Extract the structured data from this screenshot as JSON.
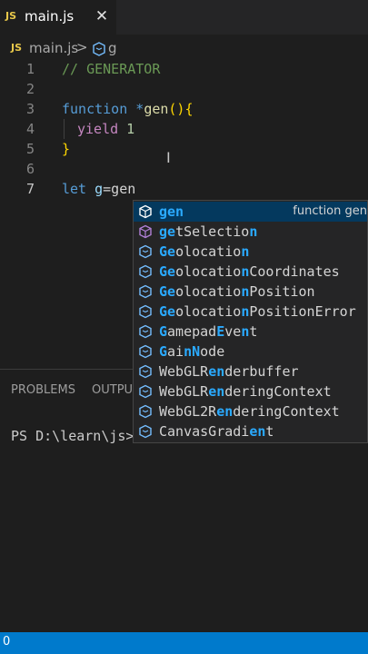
{
  "tab": {
    "badge": "JS",
    "name": "main.js",
    "close": "✕"
  },
  "breadcrumb": {
    "badge": "JS",
    "file": "main.js",
    "separator": ">",
    "symbol": "g"
  },
  "editor": {
    "lines": [
      {
        "n": "1",
        "text": "// GENERATOR"
      },
      {
        "n": "2",
        "text": ""
      },
      {
        "n": "3",
        "text": "function *gen(){"
      },
      {
        "n": "4",
        "text": "yield 1"
      },
      {
        "n": "5",
        "text": "}"
      },
      {
        "n": "6",
        "text": ""
      },
      {
        "n": "7",
        "text": "let g=gen"
      }
    ],
    "tokens": {
      "l1": "// GENERATOR",
      "l3_kw": "function",
      "l3_star": " *",
      "l3_fn": "gen",
      "l3_paren": "()",
      "l3_brace": "{",
      "l4_ctl": "yield",
      "l4_num": " 1",
      "l5_brace": "}",
      "l7_kw": "let",
      "l7_id": " g",
      "l7_rest": "=gen"
    }
  },
  "panel": {
    "tabs": [
      "PROBLEMS",
      "OUTPUT"
    ],
    "terminal_prompt": "PS D:\\learn\\js>"
  },
  "suggest": {
    "detail": "function gen",
    "items": [
      {
        "icon": "cube-icon",
        "parts": [
          [
            "gen",
            true
          ]
        ]
      },
      {
        "icon": "method-icon",
        "parts": [
          [
            "ge",
            true
          ],
          [
            "tSelectio",
            false
          ],
          [
            "n",
            true
          ]
        ]
      },
      {
        "icon": "variable-icon",
        "parts": [
          [
            "Ge",
            true
          ],
          [
            "olocatio",
            false
          ],
          [
            "n",
            true
          ]
        ]
      },
      {
        "icon": "variable-icon",
        "parts": [
          [
            "Ge",
            true
          ],
          [
            "olocatio",
            false
          ],
          [
            "n",
            true
          ],
          [
            "Coordinates",
            false
          ]
        ]
      },
      {
        "icon": "variable-icon",
        "parts": [
          [
            "Ge",
            true
          ],
          [
            "olocatio",
            false
          ],
          [
            "n",
            true
          ],
          [
            "Position",
            false
          ]
        ]
      },
      {
        "icon": "variable-icon",
        "parts": [
          [
            "Ge",
            true
          ],
          [
            "olocatio",
            false
          ],
          [
            "n",
            true
          ],
          [
            "PositionError",
            false
          ]
        ]
      },
      {
        "icon": "variable-icon",
        "parts": [
          [
            "G",
            true
          ],
          [
            "amepad",
            false
          ],
          [
            "E",
            true
          ],
          [
            "ve",
            false
          ],
          [
            "n",
            true
          ],
          [
            "t",
            false
          ]
        ]
      },
      {
        "icon": "variable-icon",
        "parts": [
          [
            "G",
            true
          ],
          [
            "ai",
            false
          ],
          [
            "nN",
            true
          ],
          [
            "ode",
            false
          ]
        ]
      },
      {
        "icon": "variable-icon",
        "parts": [
          [
            "WebGLR",
            false
          ],
          [
            "en",
            true
          ],
          [
            "derbuffer",
            false
          ]
        ]
      },
      {
        "icon": "variable-icon",
        "parts": [
          [
            "WebGLR",
            false
          ],
          [
            "en",
            true
          ],
          [
            "deringContext",
            false
          ]
        ]
      },
      {
        "icon": "variable-icon",
        "parts": [
          [
            "WebGL2R",
            false
          ],
          [
            "en",
            true
          ],
          [
            "deringContext",
            false
          ]
        ]
      },
      {
        "icon": "variable-icon",
        "parts": [
          [
            "CanvasGradi",
            false
          ],
          [
            "en",
            true
          ],
          [
            "t",
            false
          ]
        ]
      }
    ]
  },
  "statusbar": {
    "left": "0"
  },
  "colors": {
    "accent": "#007acc",
    "selection": "#04395e",
    "match": "#2aaaff"
  }
}
